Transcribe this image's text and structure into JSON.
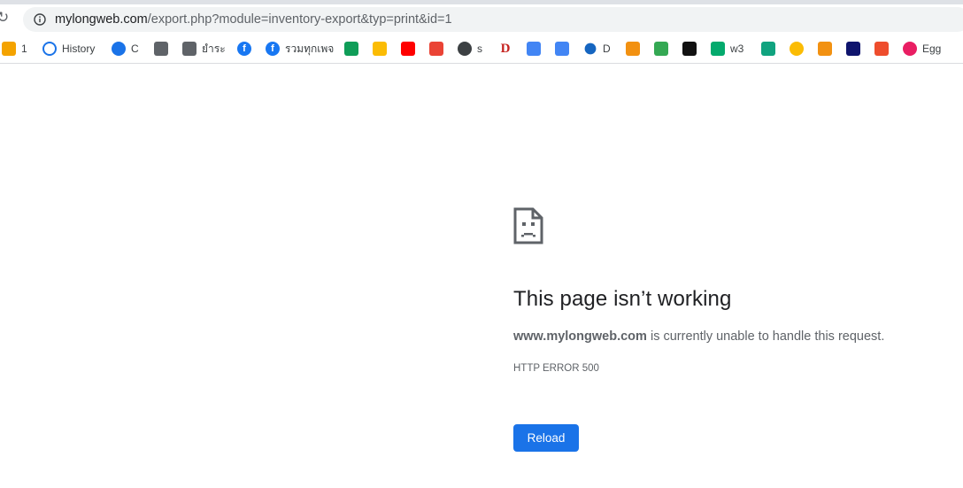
{
  "omnibox": {
    "url_host": "mylongweb.com",
    "url_path": "/export.php?module=inventory-export&typ=print&id=1"
  },
  "bookmarks": [
    {
      "label": "1",
      "icon": "rainbow-favicon-icon",
      "color": "#f4a300"
    },
    {
      "label": "History",
      "icon": "history-icon",
      "color": "#1a73e8"
    },
    {
      "label": "C",
      "icon": "gear-icon",
      "color": "#1a73e8"
    },
    {
      "label": "",
      "icon": "printer-favicon-icon",
      "color": "#5f6368"
    },
    {
      "label": "ยำระ",
      "icon": "printer-favicon-icon",
      "color": "#5f6368"
    },
    {
      "label": "",
      "icon": "facebook-icon",
      "color": "#1877f2"
    },
    {
      "label": "รวมทุกเพจ",
      "icon": "facebook-icon",
      "color": "#1877f2"
    },
    {
      "label": "",
      "icon": "google-drive-icon",
      "color": "#0f9d58"
    },
    {
      "label": "",
      "icon": "google-ads-icon",
      "color": "#fbbc04"
    },
    {
      "label": "",
      "icon": "youtube-icon",
      "color": "#ff0000"
    },
    {
      "label": "",
      "icon": "gmail-icon",
      "color": "#ea4335"
    },
    {
      "label": "s",
      "icon": "globe-icon",
      "color": "#3c4043"
    },
    {
      "label": "",
      "icon": "d-favicon-icon",
      "color": "#c5221f"
    },
    {
      "label": "",
      "icon": "calendar-icon",
      "color": "#4285f4"
    },
    {
      "label": "",
      "icon": "translate-icon",
      "color": "#4285f4"
    },
    {
      "label": "D",
      "icon": "blue-dot-icon",
      "color": "#1565c0"
    },
    {
      "label": "",
      "icon": "pma-icon",
      "color": "#f29111"
    },
    {
      "label": "",
      "icon": "diamond-favicon-icon",
      "color": "#34a853"
    },
    {
      "label": "",
      "icon": "codepen-icon",
      "color": "#111111"
    },
    {
      "label": "w3",
      "icon": "w3-favicon-icon",
      "color": "#04aa6d"
    },
    {
      "label": "",
      "icon": "hexagon-favicon-icon",
      "color": "#10a37f"
    },
    {
      "label": "",
      "icon": "smiley-icon",
      "color": "#fbbc04"
    },
    {
      "label": "",
      "icon": "pma-icon",
      "color": "#f29111"
    },
    {
      "label": "",
      "icon": "lazada-icon",
      "color": "#0f146d"
    },
    {
      "label": "",
      "icon": "shopee-icon",
      "color": "#ee4d2d"
    },
    {
      "label": "Egg",
      "icon": "egg-icon",
      "color": "#e91e63"
    }
  ],
  "error": {
    "title": "This page isn’t working",
    "host": "www.mylongweb.com",
    "message": " is currently unable to handle this request.",
    "code": "HTTP ERROR 500",
    "reload_label": "Reload"
  },
  "colors": {
    "accent": "#1a73e8",
    "text_primary": "#202124",
    "text_secondary": "#5f6368"
  }
}
